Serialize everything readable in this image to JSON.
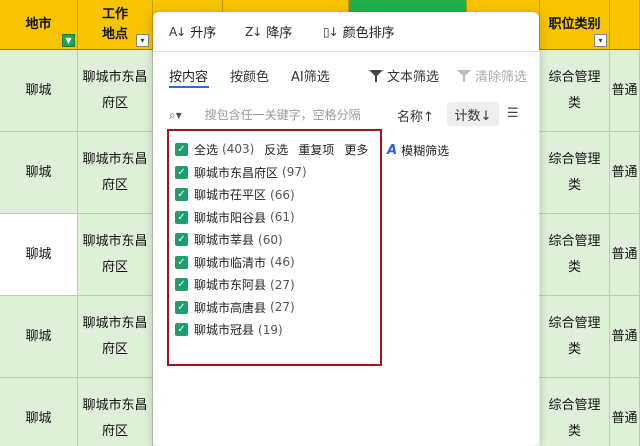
{
  "sheet": {
    "headers": {
      "city": "地市",
      "location_line1": "工作",
      "location_line2": "地点",
      "category_line1": "职位类别",
      "last": ""
    },
    "rows": [
      {
        "city": "聊城",
        "location_line1": "聊城市东昌",
        "location_line2": "府区",
        "category_line1": "综合管理",
        "category_line2": "类",
        "last": "普通"
      },
      {
        "city": "聊城",
        "location_line1": "聊城市东昌",
        "location_line2": "府区",
        "category_line1": "综合管理",
        "category_line2": "类",
        "last": "普通"
      },
      {
        "city": "聊城",
        "location_line1": "聊城市东昌",
        "location_line2": "府区",
        "category_line1": "综合管理",
        "category_line2": "类",
        "last": "普通"
      },
      {
        "city": "聊城",
        "location_line1": "聊城市东昌",
        "location_line2": "府区",
        "category_line1": "综合管理",
        "category_line2": "类",
        "last": "普通"
      },
      {
        "city": "聊城",
        "location_line1": "聊城市东昌",
        "location_line2": "府区",
        "category_line1": "综合管理",
        "category_line2": "类",
        "last": "普通"
      }
    ]
  },
  "popup": {
    "sort": {
      "ascending": "升序",
      "descending": "降序",
      "by_color": "颜色排序"
    },
    "tabs": {
      "by_content": "按内容",
      "by_color": "按颜色",
      "ai_filter": "AI筛选",
      "text_filter": "文本筛选",
      "clear_filter": "清除筛选"
    },
    "search": {
      "placeholder": "搜包含任一关键字，空格分隔",
      "sort_name": "名称↑",
      "sort_count": "计数↓"
    },
    "select_all": {
      "label": "全选",
      "count": "(403)",
      "invert": "反选",
      "duplicates": "重复项",
      "more": "更多"
    },
    "fuzzy_filter": "模糊筛选",
    "items": [
      {
        "label": "聊城市东昌府区",
        "count": "(97)"
      },
      {
        "label": "聊城市茌平区",
        "count": "(66)"
      },
      {
        "label": "聊城市阳谷县",
        "count": "(61)"
      },
      {
        "label": "聊城市莘县",
        "count": "(60)"
      },
      {
        "label": "聊城市临清市",
        "count": "(46)"
      },
      {
        "label": "聊城市东阿县",
        "count": "(27)"
      },
      {
        "label": "聊城市高唐县",
        "count": "(27)"
      },
      {
        "label": "聊城市冠县",
        "count": "(19)"
      }
    ]
  },
  "colors": {
    "header_yellow": "#f7c400",
    "header_green": "#21b04b",
    "row_green": "#dff0d8",
    "checkbox": "#1e9e6a",
    "highlight_box": "#a01616",
    "tab_active": "#1a73e8"
  },
  "icons": {
    "sort_asc": "sort-ascending-icon",
    "sort_desc": "sort-descending-icon",
    "color_sort": "color-sort-icon",
    "text_filter": "funnel-icon",
    "clear_filter": "funnel-clear-icon",
    "search": "search-scope-icon",
    "settings": "list-settings-icon",
    "fuzzy": "fuzzy-filter-icon"
  }
}
